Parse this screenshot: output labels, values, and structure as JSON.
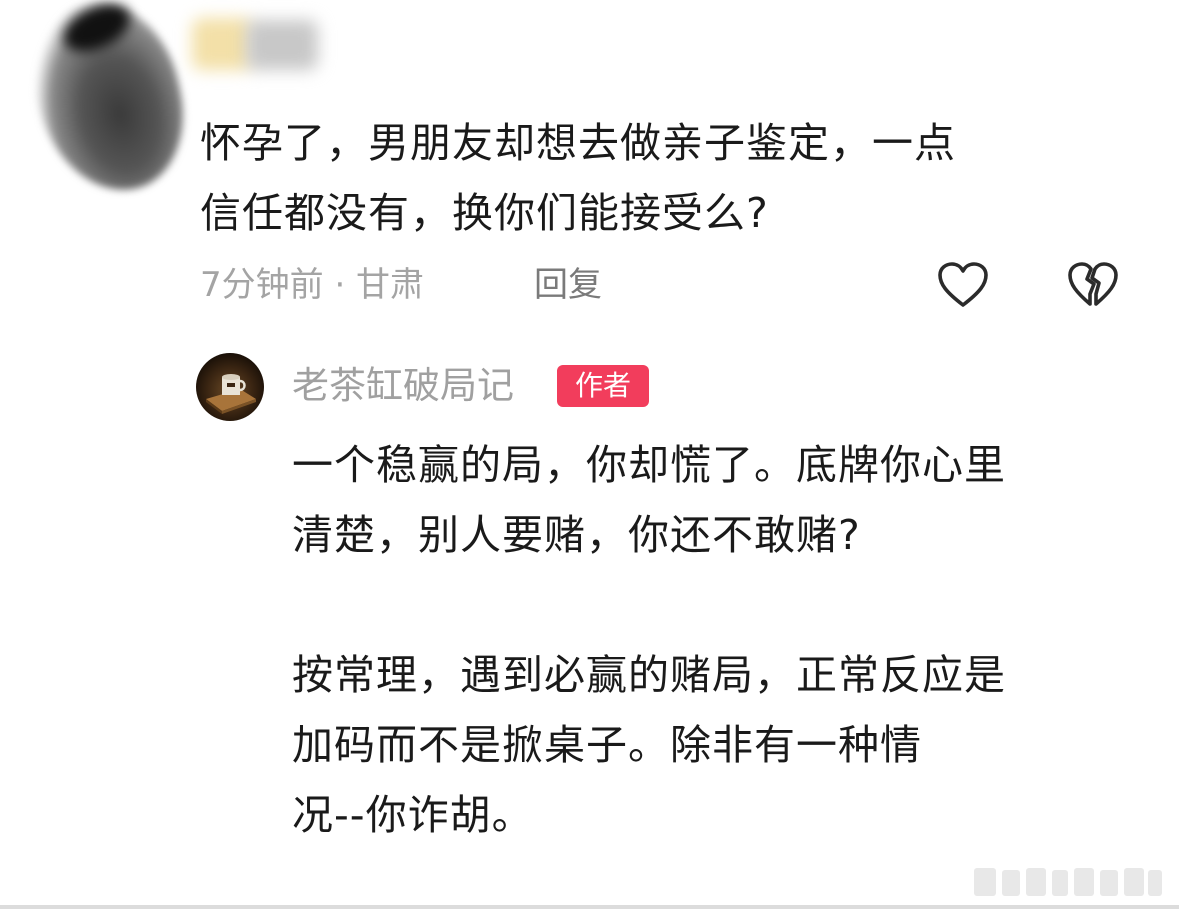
{
  "comment": {
    "text_lines": [
      "怀孕了，男朋友却想去做亲子鉴定，一点",
      "信任都没有，换你们能接受么?"
    ],
    "meta": "7分钟前 · 甘肃",
    "reply_label": "回复",
    "icons": {
      "like": "heart-outline-icon",
      "dislike": "broken-heart-icon"
    }
  },
  "reply": {
    "author_name": "老茶缸破局记",
    "badge": "作者",
    "paragraphs": [
      [
        "一个稳赢的局，你却慌了。底牌你心里",
        "清楚，别人要赌，你还不敢赌?"
      ],
      [
        "按常理，遇到必赢的赌局，正常反应是",
        "加码而不是掀桌子。除非有一种情",
        "况--你诈胡。"
      ]
    ]
  },
  "colors": {
    "text": "#1a1a1a",
    "meta": "#a4a4a4",
    "badge_bg": "#f23d5c",
    "badge_text": "#ffffff"
  }
}
